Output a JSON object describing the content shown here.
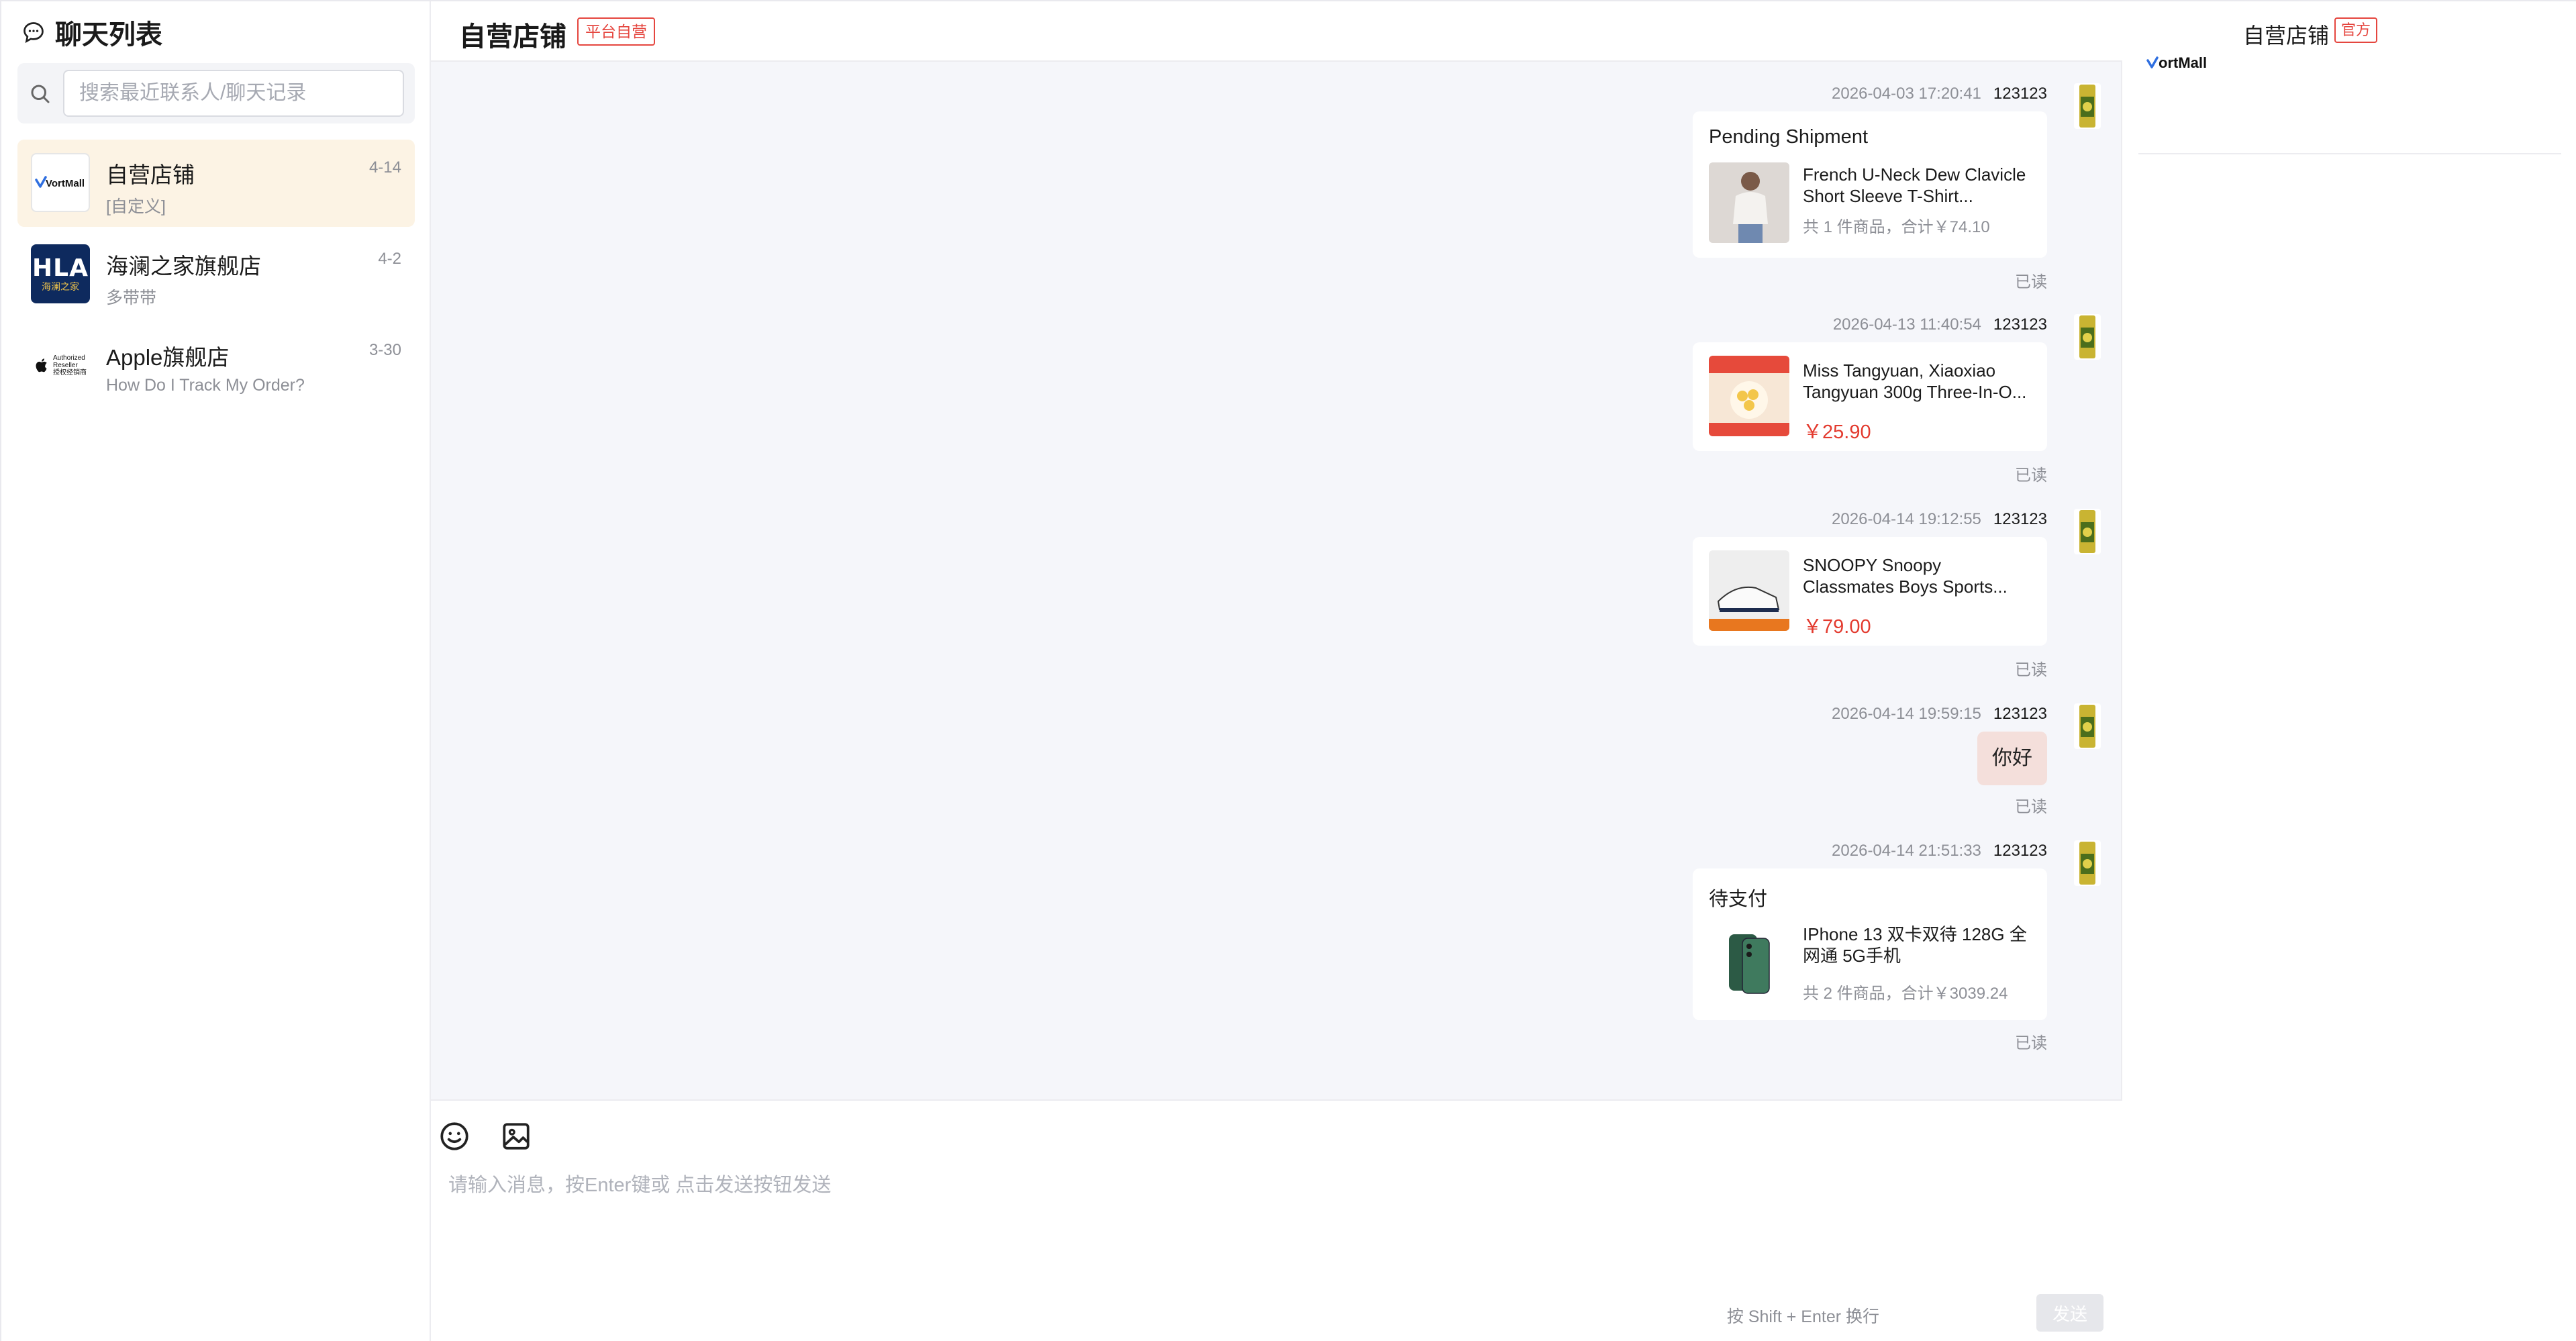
{
  "sidebar": {
    "title": "聊天列表",
    "search_placeholder": "搜索最近联系人/聊天记录",
    "contacts": [
      {
        "name": "自营店铺",
        "preview": "[自定义]",
        "date": "4-14",
        "active": true,
        "logo_text": "VortMall"
      },
      {
        "name": "海澜之家旗舰店",
        "preview": "多带带",
        "date": "4-2",
        "logo_text": "HLA",
        "logo_subtext": "海澜之家"
      },
      {
        "name": "Apple旗舰店",
        "preview": "How Do I Track My Order?",
        "date": "3-30",
        "logo_text_lines": [
          "Authorized",
          "Reseller",
          "授权经销商"
        ]
      }
    ]
  },
  "header": {
    "title": "自营店铺",
    "badge": "平台自营"
  },
  "messages": [
    {
      "time": "2026-04-03 17:20:41",
      "user": "123123",
      "kind": "order",
      "title": "Pending Shipment",
      "product": "French U-Neck Dew Clavicle Short Sleeve T-Shirt...",
      "summary": "共 1 件商品，合计￥74.10",
      "status": "已读"
    },
    {
      "time": "2026-04-13 11:40:54",
      "user": "123123",
      "kind": "product",
      "product": "Miss Tangyuan, Xiaoxiao Tangyuan 300g Three-In-O...",
      "price": "￥25.90",
      "status": "已读"
    },
    {
      "time": "2026-04-14 19:12:55",
      "user": "123123",
      "kind": "product",
      "product": "SNOOPY Snoopy Classmates Boys Sports...",
      "price": "￥79.00",
      "status": "已读"
    },
    {
      "time": "2026-04-14 19:59:15",
      "user": "123123",
      "kind": "text",
      "text": "你好",
      "status": "已读"
    },
    {
      "time": "2026-04-14 21:51:33",
      "user": "123123",
      "kind": "order",
      "title": "待支付",
      "product": "IPhone 13 双卡双待 128G 全网通 5G手机",
      "summary": "共 2 件商品，合计￥3039.24",
      "status": "已读"
    }
  ],
  "composer": {
    "placeholder": "请输入消息，按Enter键或 点击发送按钮发送",
    "hint": "按 Shift + Enter 换行",
    "send_label": "发送"
  },
  "right_panel": {
    "store_name": "自营店铺",
    "badge": "官方",
    "logo_text": "ortMall"
  },
  "colors": {
    "accent_red": "#e5463f",
    "price_red": "#e33b2f",
    "active_contact_bg": "#fcf3e4",
    "bubble_bg": "#f4dfdb"
  }
}
